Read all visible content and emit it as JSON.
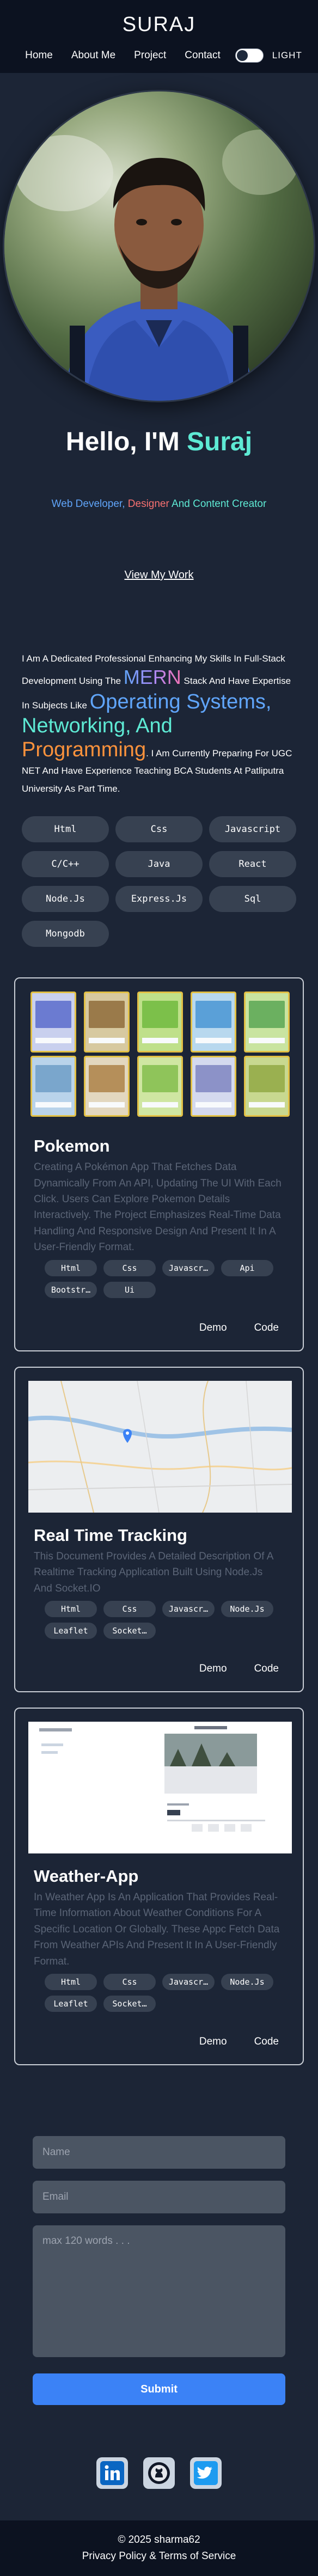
{
  "nav": {
    "brand": "SURAJ",
    "links": [
      "Home",
      "About Me",
      "Project",
      "Contact"
    ],
    "theme_label": "LIGHT"
  },
  "hero": {
    "greeting": "Hello, I'M ",
    "name": "Suraj",
    "role1": "Web Developer, ",
    "role2": "Designer",
    "role3": " And Content Creator",
    "cta": "View My Work"
  },
  "about": {
    "p1": "I Am A Dedicated Professional Enhancing My Skills In Full-Stack Development Using The ",
    "mern": "MERN",
    "p2": " Stack And Have Expertise In Subjects Like ",
    "os_a": "Operating Systems,",
    "os_b": "Networking, And",
    "prog": "Programming",
    "p3": ". I Am Currently Preparing For UGC NET And Have Experience Teaching BCA Students At Patliputra University As Part Time."
  },
  "skills": [
    "Html",
    "Css",
    "Javascript",
    "C/C++",
    "Java",
    "React",
    "Node.Js",
    "Express.Js",
    "Sql",
    "Mongodb"
  ],
  "projects": [
    {
      "title": "Pokemon",
      "description": "Creating A Pokémon App That Fetches Data Dynamically From An API, Updating The UI With Each Click. Users Can Explore Pokemon Details Interactively. The Project Emphasizes Real-Time Data Handling And Responsive Design And Present It In A User-Friendly Format.",
      "tags": [
        "Html",
        "Css",
        "Javascr…",
        "Api",
        "Bootstr…",
        "Ui"
      ],
      "demo": "Demo",
      "code": "Code"
    },
    {
      "title": "Real Time Tracking",
      "description": "This Document Provides A Detailed Description Of A Realtime Tracking Application Built Using Node.Js And Socket.IO",
      "tags": [
        "Html",
        "Css",
        "Javascr…",
        "Node.Js",
        "Leaflet",
        "Socket…"
      ],
      "demo": "Demo",
      "code": "Code"
    },
    {
      "title": "Weather-App",
      "description": "In Weather App Is An Application That Provides Real-Time Information About Weather Conditions For A Specific Location Or Globally. These Appc Fetch Data From Weather APIs And Present It In A User-Friendly Format.",
      "tags": [
        "Html",
        "Css",
        "Javascr…",
        "Node.Js",
        "Leaflet",
        "Socket…"
      ],
      "demo": "Demo",
      "code": "Code"
    }
  ],
  "contact": {
    "name_placeholder": "Name",
    "email_placeholder": "Email",
    "message_placeholder": "max 120 words . . .",
    "submit": "Submit"
  },
  "socials": [
    "linkedin-icon",
    "github-icon",
    "twitter-icon"
  ],
  "footer": {
    "copyright": "© 2025 sharma62",
    "links": "Privacy Policy & Terms of Service"
  },
  "colors": {
    "background": "#1c2536",
    "accent_teal": "#5eead4",
    "accent_blue": "#3b82f6",
    "chip": "#374151"
  }
}
